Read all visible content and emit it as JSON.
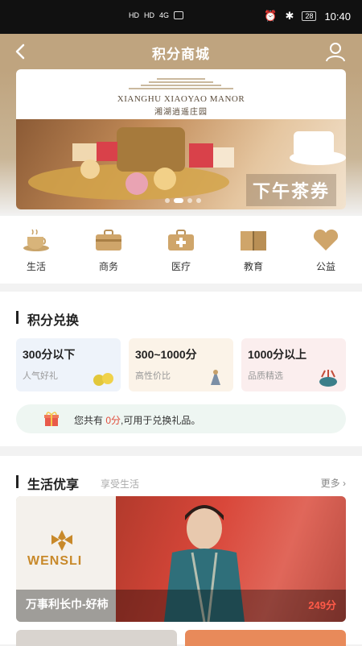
{
  "statusbar": {
    "time": "10:40",
    "battery": "28",
    "network_1": "HD",
    "network_2": "HD",
    "signal": "4G"
  },
  "header": {
    "title": "积分商城"
  },
  "hero": {
    "logo_en": "XIANGHU XIAOYAO MANOR",
    "logo_cn": "湘湖逍遥庄园",
    "banner_text": "下午茶券"
  },
  "categories": [
    {
      "label": "生活",
      "icon": "coffee-icon"
    },
    {
      "label": "商务",
      "icon": "briefcase-icon"
    },
    {
      "label": "医疗",
      "icon": "medical-kit-icon"
    },
    {
      "label": "教育",
      "icon": "book-icon"
    },
    {
      "label": "公益",
      "icon": "heart-icon"
    }
  ],
  "exchange": {
    "title": "积分兑换",
    "cards": [
      {
        "title": "300分以下",
        "subtitle": "人气好礼",
        "bg": "#eef3fa"
      },
      {
        "title": "300~1000分",
        "subtitle": "高性价比",
        "bg": "#fbf3e8"
      },
      {
        "title": "1000分以上",
        "subtitle": "品质精选",
        "bg": "#fbeeee"
      }
    ],
    "note_prefix": "您共有",
    "note_points": "0分",
    "note_suffix": ",可用于兑换礼品。"
  },
  "life": {
    "title": "生活优享",
    "subtitle": "享受生活",
    "more": "更多",
    "product": {
      "brand": "WENSLI",
      "name": "万事利长巾-好柿",
      "price": "249分"
    }
  },
  "colors": {
    "accent": "#bfa47f",
    "price_red": "#ff5a48"
  }
}
